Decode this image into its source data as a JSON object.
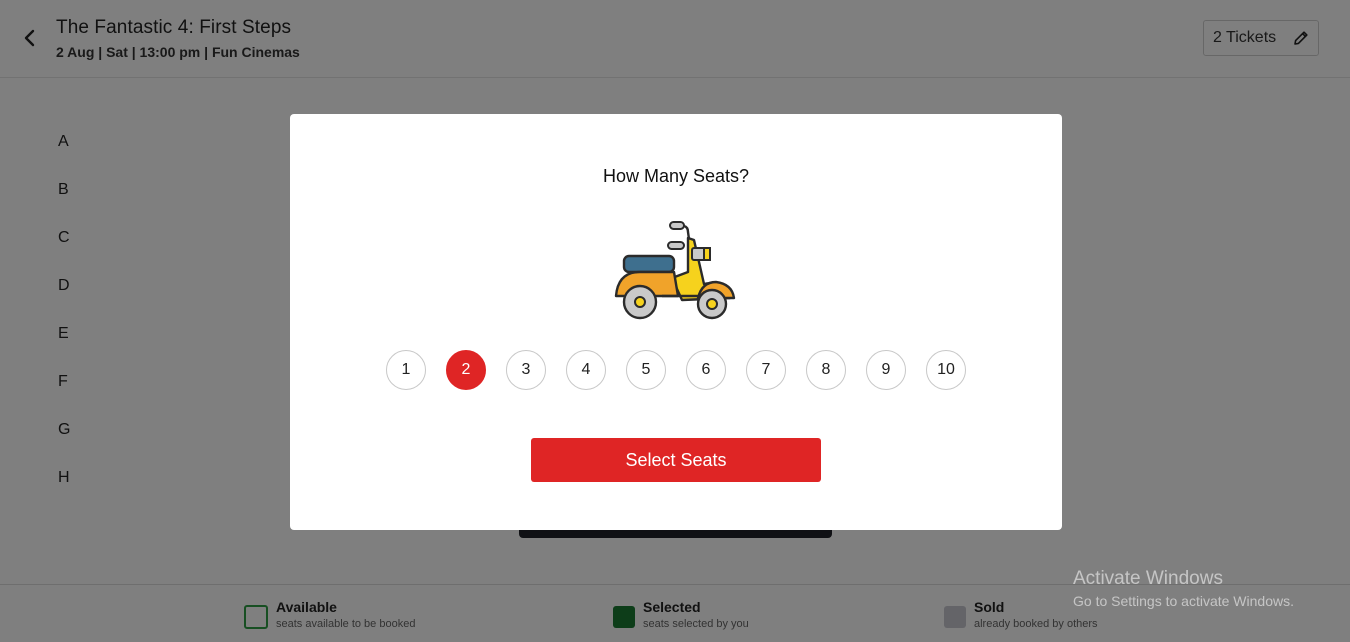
{
  "header": {
    "title": "The Fantastic 4: First Steps",
    "subtitle": "2 Aug | Sat | 13:00 pm | Fun Cinemas",
    "tickets_label": "2 Tickets"
  },
  "rows": [
    "A",
    "B",
    "C",
    "D",
    "E",
    "F",
    "G",
    "H"
  ],
  "legend": [
    {
      "title": "Available",
      "desc": "seats available to be booked",
      "color": "#ffffff",
      "border": "#2e9e45"
    },
    {
      "title": "Selected",
      "desc": "seats selected by you",
      "color": "#1a7a32",
      "border": "#1a7a32"
    },
    {
      "title": "Sold",
      "desc": "already booked by others",
      "color": "#c9c9d0",
      "border": "#c9c9d0"
    }
  ],
  "modal": {
    "title": "How Many Seats?",
    "options": [
      "1",
      "2",
      "3",
      "4",
      "5",
      "6",
      "7",
      "8",
      "9",
      "10"
    ],
    "selected": "2",
    "button_label": "Select Seats",
    "illustration": "scooter-icon"
  },
  "watermark": {
    "title": "Activate Windows",
    "subtitle": "Go to Settings to activate Windows."
  },
  "colors": {
    "accent": "#df2525",
    "overlay": "rgba(0,0,0,0.5)"
  }
}
